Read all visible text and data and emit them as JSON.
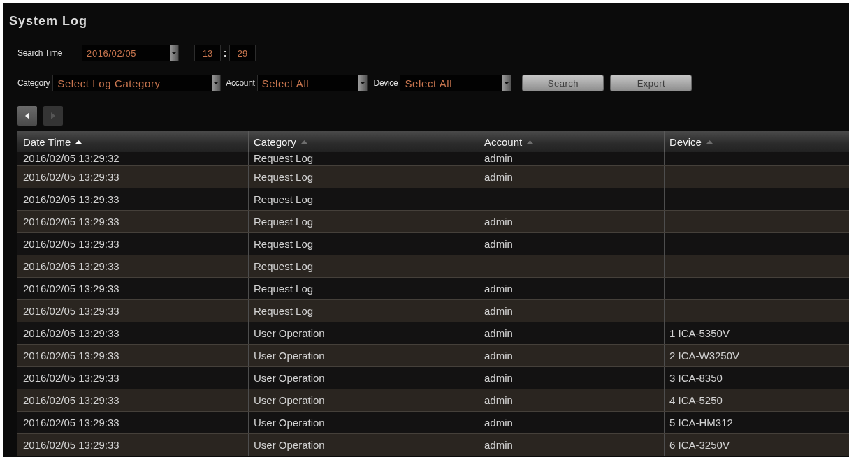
{
  "title": "System Log",
  "search_time": {
    "label": "Search Time",
    "date": "2016/02/05",
    "hour": "13",
    "separator": ":",
    "minute": "29"
  },
  "filters": [
    {
      "label": "Category",
      "value": "Select Log Category"
    },
    {
      "label": "Account",
      "value": "Select All"
    },
    {
      "label": "Device",
      "value": "Select All"
    }
  ],
  "buttons": [
    "Search",
    "Export"
  ],
  "pager": {
    "previous": {
      "disabled": false
    },
    "next": {
      "disabled": true
    }
  },
  "table": {
    "columns": [
      {
        "label": "Date Time",
        "sorted": true
      },
      {
        "label": "Category",
        "sorted": false
      },
      {
        "label": "Account",
        "sorted": false
      },
      {
        "label": "Device",
        "sorted": false
      }
    ],
    "rows": [
      {
        "date_time": "2016/02/05 13:29:32",
        "category": "Request Log",
        "account": "admin"
      },
      {
        "date_time": "2016/02/05 13:29:33",
        "category": "Request Log",
        "account": "admin"
      },
      {
        "date_time": "2016/02/05 13:29:33",
        "category": "Request Log"
      },
      {
        "date_time": "2016/02/05 13:29:33",
        "category": "Request Log",
        "account": "admin"
      },
      {
        "date_time": "2016/02/05 13:29:33",
        "category": "Request Log",
        "account": "admin"
      },
      {
        "date_time": "2016/02/05 13:29:33",
        "category": "Request Log"
      },
      {
        "date_time": "2016/02/05 13:29:33",
        "category": "Request Log",
        "account": "admin"
      },
      {
        "date_time": "2016/02/05 13:29:33",
        "category": "Request Log",
        "account": "admin"
      },
      {
        "date_time": "2016/02/05 13:29:33",
        "category": "User Operation",
        "account": "admin",
        "device": "1 ICA-5350V"
      },
      {
        "date_time": "2016/02/05 13:29:33",
        "category": "User Operation",
        "account": "admin",
        "device": "2 ICA-W3250V"
      },
      {
        "date_time": "2016/02/05 13:29:33",
        "category": "User Operation",
        "account": "admin",
        "device": "3 ICA-8350"
      },
      {
        "date_time": "2016/02/05 13:29:33",
        "category": "User Operation",
        "account": "admin",
        "device": "4 ICA-5250"
      },
      {
        "date_time": "2016/02/05 13:29:33",
        "category": "User Operation",
        "account": "admin",
        "device": "5 ICA-HM312"
      },
      {
        "date_time": "2016/02/05 13:29:33",
        "category": "User Operation",
        "account": "admin",
        "device": "6 ICA-3250V"
      }
    ]
  }
}
